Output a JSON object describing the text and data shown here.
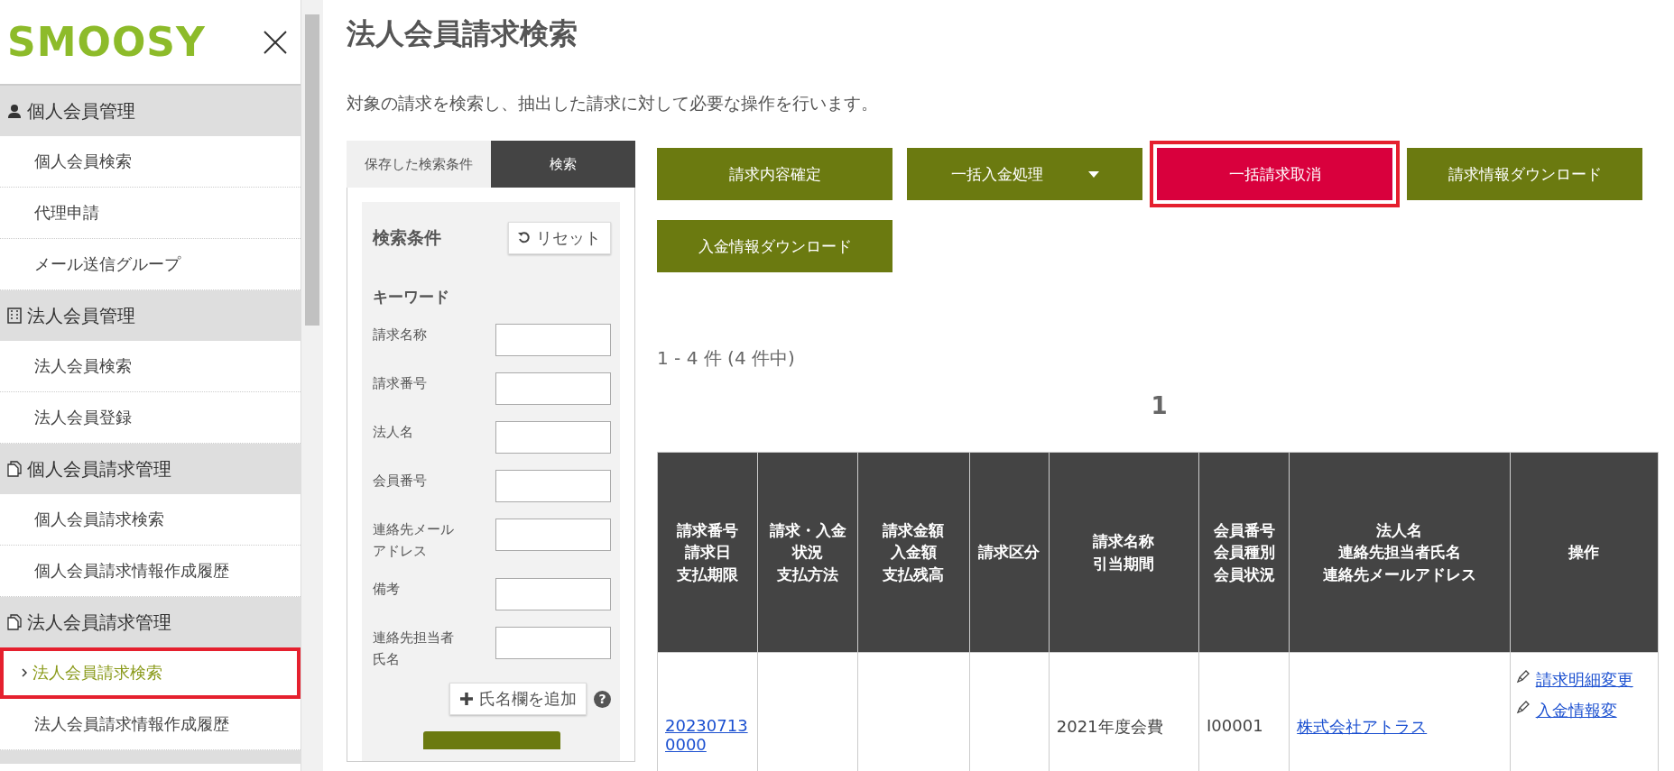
{
  "sidebar": {
    "logo": "SMOOSY",
    "groups": [
      {
        "title": "個人会員管理",
        "items": [
          {
            "label": "個人会員検索",
            "selected": false
          },
          {
            "label": "代理申請",
            "selected": false
          },
          {
            "label": "メール送信グループ",
            "selected": false
          }
        ]
      },
      {
        "title": "法人会員管理",
        "items": [
          {
            "label": "法人会員検索",
            "selected": false
          },
          {
            "label": "法人会員登録",
            "selected": false
          }
        ]
      },
      {
        "title": "個人会員請求管理",
        "items": [
          {
            "label": "個人会員請求検索",
            "selected": false
          },
          {
            "label": "個人会員請求情報作成履歴",
            "selected": false
          }
        ]
      },
      {
        "title": "法人会員請求管理",
        "items": [
          {
            "label": "法人会員請求検索",
            "selected": true,
            "highlighted": true
          },
          {
            "label": "法人会員請求情報作成履歴",
            "selected": false
          }
        ]
      }
    ]
  },
  "page": {
    "title": "法人会員請求検索",
    "description": "対象の請求を検索し、抽出した請求に対して必要な操作を行います。"
  },
  "search_panel": {
    "tabs": [
      {
        "label": "保存した検索条件",
        "selected": false
      },
      {
        "label": "検索",
        "selected": true
      }
    ],
    "heading": "検索条件",
    "reset": "リセット",
    "section": "キーワード",
    "fields": [
      {
        "label": "請求名称"
      },
      {
        "label": "請求番号"
      },
      {
        "label": "法人名"
      },
      {
        "label": "会員番号"
      },
      {
        "label": "連絡先メールアドレス"
      },
      {
        "label": "備考"
      },
      {
        "label": "連絡先担当者氏名"
      }
    ],
    "add_button": "氏名欄を追加",
    "help": "?"
  },
  "actions": [
    {
      "label": "請求内容確定",
      "kind": "primary",
      "dropdown": false,
      "highlighted": false
    },
    {
      "label": "一括入金処理",
      "kind": "primary",
      "dropdown": true,
      "highlighted": false
    },
    {
      "label": "一括請求取消",
      "kind": "danger",
      "dropdown": false,
      "highlighted": true
    },
    {
      "label": "請求情報ダウンロード",
      "kind": "primary",
      "dropdown": false,
      "highlighted": false
    },
    {
      "label": "入金情報ダウンロード",
      "kind": "primary",
      "dropdown": false,
      "highlighted": false
    }
  ],
  "result_count": "1 - 4 件 (4 件中)",
  "pagination": [
    "1"
  ],
  "table": {
    "columns": [
      {
        "lines": [
          "請求番号",
          "請求日",
          "支払期限"
        ]
      },
      {
        "lines": [
          "請求・入金状況",
          "支払方法"
        ]
      },
      {
        "lines": [
          "請求金額",
          "入金額",
          "支払残高"
        ]
      },
      {
        "lines": [
          "請求区分"
        ]
      },
      {
        "lines": [
          "請求名称",
          "引当期間"
        ]
      },
      {
        "lines": [
          "会員番号",
          "会員種別",
          "会員状況"
        ]
      },
      {
        "lines": [
          "法人名",
          "連絡先担当者氏名",
          "連絡先メールアドレス"
        ]
      },
      {
        "lines": [
          "操作"
        ]
      }
    ],
    "rows": [
      {
        "cells": [
          {
            "text": "202307130000",
            "kind": "link"
          },
          {
            "kind": "empty"
          },
          {
            "kind": "empty"
          },
          {
            "kind": "empty"
          },
          {
            "text": "2021年度会費",
            "kind": "text"
          },
          {
            "text": "I00001",
            "kind": "text"
          },
          {
            "text": "株式会社アトラス",
            "kind": "link"
          },
          {
            "kind": "actions",
            "links": [
              "請求明細変更",
              "入金情報変"
            ]
          }
        ]
      }
    ]
  }
}
